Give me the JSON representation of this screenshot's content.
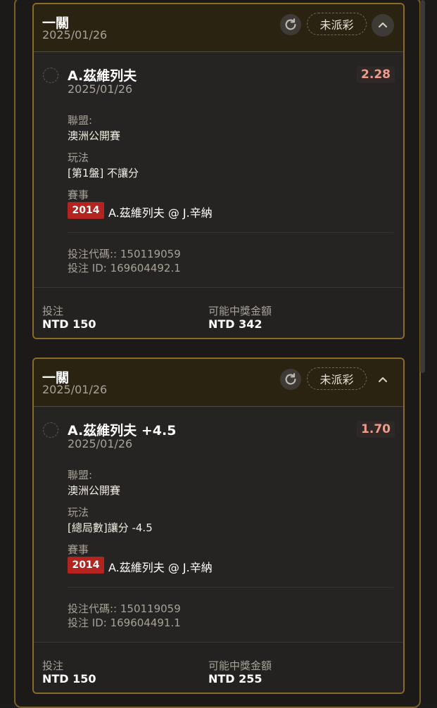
{
  "tickets": [
    {
      "header_title": "一關",
      "header_date": "2025/01/26",
      "status": "未派彩",
      "selection_name": "A.茲維列夫",
      "selection_date": "2025/01/26",
      "odds": "2.28",
      "league_label": "聯盟:",
      "league": "澳洲公開賽",
      "market_label": "玩法",
      "market": "[第1盤] 不讓分",
      "event_label": "賽事",
      "event_year": "2014",
      "event_name": "A.茲維列夫 @ J.辛納",
      "bet_code": "投注代碼:: 150119059",
      "bet_id": "投注 ID: 169604492.1",
      "stake_label": "投注",
      "stake": "NTD 150",
      "payout_label": "可能中獎金額",
      "payout": "NTD 342"
    },
    {
      "header_title": "一關",
      "header_date": "2025/01/26",
      "status": "未派彩",
      "selection_name": "A.茲維列夫 +4.5",
      "selection_date": "2025/01/26",
      "odds": "1.70",
      "league_label": "聯盟:",
      "league": "澳洲公開賽",
      "market_label": "玩法",
      "market": "[總局數]讓分 -4.5",
      "event_label": "賽事",
      "event_year": "2014",
      "event_name": "A.茲維列夫 @ J.辛納",
      "bet_code": "投注代碼:: 150119059",
      "bet_id": "投注 ID: 169604491.1",
      "stake_label": "投注",
      "stake": "NTD 150",
      "payout_label": "可能中獎金額",
      "payout": "NTD 255"
    }
  ],
  "icons": {
    "refresh": "refresh-icon",
    "collapse": "chevron-up-icon"
  },
  "colors": {
    "card_border": "#8c6a2c",
    "odds": "#ef9a8c",
    "year_badge": "#b3231f"
  }
}
